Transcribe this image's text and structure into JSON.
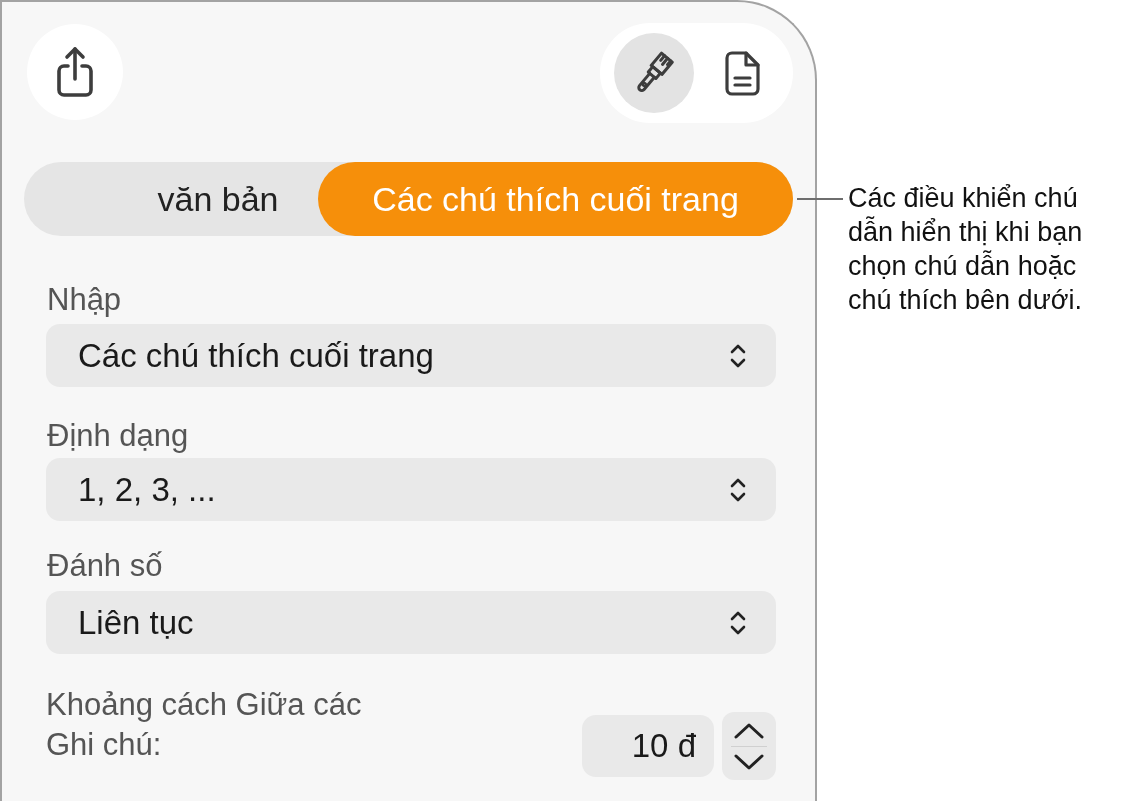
{
  "toolbar": {
    "inspector_buttons": [
      {
        "kind": "format",
        "selected": true
      },
      {
        "kind": "document",
        "selected": false
      }
    ]
  },
  "segments": [
    {
      "label": "văn bản",
      "selected": false
    },
    {
      "label": "Các chú thích cuối trang",
      "selected": true
    }
  ],
  "fields": [
    {
      "label": "Nhập",
      "value": "Các chú thích cuối trang"
    },
    {
      "label": "Định dạng",
      "value": "1, 2, 3, ..."
    },
    {
      "label": "Đánh số",
      "value": "Liên tục"
    }
  ],
  "spacing": {
    "label": "Khoảng cách Giữa các Ghi chú:",
    "value": "10 đ"
  },
  "callout": {
    "text": "Các điều khiển chú dẫn hiển thị khi bạn chọn chú dẫn hoặc chú thích bên dưới."
  }
}
